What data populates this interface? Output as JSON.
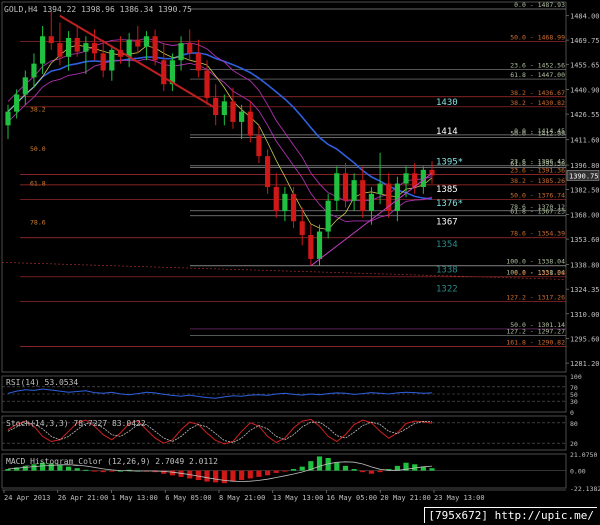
{
  "chart_data": [
    {
      "type": "candlestick",
      "panel": "price",
      "header": "GOLD,H4  1394.22 1398.96 1386.34 1390.75",
      "yticks": [
        "1484.00",
        "1469.75",
        "1455.65",
        "1440.90",
        "1426.55",
        "1411.60",
        "1396.80",
        "1382.50",
        "1368.00",
        "1353.60",
        "1338.80",
        "1324.35",
        "1310.00",
        "1295.60",
        "1281.20"
      ],
      "ylim": [
        1276,
        1492
      ],
      "current_price": "1390.75",
      "xticks": [
        "24 Apr 2013",
        "26 Apr 21:00",
        "1 May 13:00",
        "6 May 05:00",
        "8 May 21:00",
        "13 May 13:00",
        "16 May 05:00",
        "20 May 21:00",
        "23 May 13:00"
      ],
      "candles": [
        {
          "o": 1420.0,
          "h": 1432.0,
          "l": 1412.0,
          "c": 1428.0
        },
        {
          "o": 1428.0,
          "h": 1441.0,
          "l": 1424.0,
          "c": 1438.0
        },
        {
          "o": 1438.0,
          "h": 1452.0,
          "l": 1432.0,
          "c": 1448.0
        },
        {
          "o": 1448.0,
          "h": 1462.0,
          "l": 1442.0,
          "c": 1456.0
        },
        {
          "o": 1456.0,
          "h": 1478.0,
          "l": 1450.0,
          "c": 1472.0
        },
        {
          "o": 1472.0,
          "h": 1487.0,
          "l": 1464.0,
          "c": 1468.0
        },
        {
          "o": 1468.0,
          "h": 1480.0,
          "l": 1455.0,
          "c": 1460.0
        },
        {
          "o": 1460.0,
          "h": 1475.0,
          "l": 1452.0,
          "c": 1471.0
        },
        {
          "o": 1471.0,
          "h": 1478.0,
          "l": 1460.0,
          "c": 1463.0
        },
        {
          "o": 1463.0,
          "h": 1472.0,
          "l": 1450.0,
          "c": 1468.0
        },
        {
          "o": 1468.0,
          "h": 1476.0,
          "l": 1458.0,
          "c": 1462.0
        },
        {
          "o": 1462.0,
          "h": 1470.0,
          "l": 1448.0,
          "c": 1452.0
        },
        {
          "o": 1452.0,
          "h": 1466.0,
          "l": 1446.0,
          "c": 1464.0
        },
        {
          "o": 1464.0,
          "h": 1472.0,
          "l": 1456.0,
          "c": 1460.0
        },
        {
          "o": 1460.0,
          "h": 1474.0,
          "l": 1454.0,
          "c": 1470.0
        },
        {
          "o": 1470.0,
          "h": 1478.0,
          "l": 1462.0,
          "c": 1466.0
        },
        {
          "o": 1466.0,
          "h": 1475.0,
          "l": 1458.0,
          "c": 1472.0
        },
        {
          "o": 1472.0,
          "h": 1476.0,
          "l": 1455.0,
          "c": 1458.0
        },
        {
          "o": 1458.0,
          "h": 1468.0,
          "l": 1440.0,
          "c": 1444.0
        },
        {
          "o": 1444.0,
          "h": 1462.0,
          "l": 1440.0,
          "c": 1458.0
        },
        {
          "o": 1458.0,
          "h": 1472.0,
          "l": 1452.0,
          "c": 1468.0
        },
        {
          "o": 1468.0,
          "h": 1476.0,
          "l": 1458.0,
          "c": 1462.0
        },
        {
          "o": 1462.0,
          "h": 1470.0,
          "l": 1448.0,
          "c": 1452.0
        },
        {
          "o": 1452.0,
          "h": 1458.0,
          "l": 1432.0,
          "c": 1436.0
        },
        {
          "o": 1436.0,
          "h": 1444.0,
          "l": 1420.0,
          "c": 1426.0
        },
        {
          "o": 1426.0,
          "h": 1438.0,
          "l": 1420.0,
          "c": 1434.0
        },
        {
          "o": 1434.0,
          "h": 1442.0,
          "l": 1418.0,
          "c": 1422.0
        },
        {
          "o": 1422.0,
          "h": 1432.0,
          "l": 1412.0,
          "c": 1428.0
        },
        {
          "o": 1428.0,
          "h": 1434.0,
          "l": 1410.0,
          "c": 1414.0
        },
        {
          "o": 1414.0,
          "h": 1420.0,
          "l": 1398.0,
          "c": 1402.0
        },
        {
          "o": 1402.0,
          "h": 1406.0,
          "l": 1380.0,
          "c": 1384.0
        },
        {
          "o": 1384.0,
          "h": 1392.0,
          "l": 1366.0,
          "c": 1370.0
        },
        {
          "o": 1370.0,
          "h": 1384.0,
          "l": 1364.0,
          "c": 1380.0
        },
        {
          "o": 1380.0,
          "h": 1384.0,
          "l": 1360.0,
          "c": 1364.0
        },
        {
          "o": 1364.0,
          "h": 1372.0,
          "l": 1350.0,
          "c": 1356.0
        },
        {
          "o": 1356.0,
          "h": 1362.0,
          "l": 1338.0,
          "c": 1342.0
        },
        {
          "o": 1342.0,
          "h": 1362.0,
          "l": 1338.0,
          "c": 1358.0
        },
        {
          "o": 1358.0,
          "h": 1380.0,
          "l": 1354.0,
          "c": 1376.0
        },
        {
          "o": 1376.0,
          "h": 1396.0,
          "l": 1370.0,
          "c": 1392.0
        },
        {
          "o": 1392.0,
          "h": 1398.0,
          "l": 1372.0,
          "c": 1376.0
        },
        {
          "o": 1376.0,
          "h": 1392.0,
          "l": 1370.0,
          "c": 1388.0
        },
        {
          "o": 1388.0,
          "h": 1396.0,
          "l": 1366.0,
          "c": 1370.0
        },
        {
          "o": 1370.0,
          "h": 1384.0,
          "l": 1362.0,
          "c": 1380.0
        },
        {
          "o": 1380.0,
          "h": 1404.0,
          "l": 1374.0,
          "c": 1386.0
        },
        {
          "o": 1386.0,
          "h": 1392.0,
          "l": 1366.0,
          "c": 1370.0
        },
        {
          "o": 1370.0,
          "h": 1390.0,
          "l": 1364.0,
          "c": 1386.0
        },
        {
          "o": 1386.0,
          "h": 1396.0,
          "l": 1378.0,
          "c": 1392.0
        },
        {
          "o": 1392.0,
          "h": 1398.0,
          "l": 1380.0,
          "c": 1384.0
        },
        {
          "o": 1384.0,
          "h": 1396.0,
          "l": 1380.0,
          "c": 1394.0
        },
        {
          "o": 1394.0,
          "h": 1399.0,
          "l": 1386.0,
          "c": 1390.75
        }
      ],
      "fib_levels": [
        {
          "label": "0.0 - 1487.93",
          "price": 1487.93,
          "color": "#8a8a8a"
        },
        {
          "label": "50.0 - 1468.99",
          "price": 1468.99,
          "color": "#b03030"
        },
        {
          "label": "23.6 - 1452.56",
          "price": 1452.56,
          "color": "#8a8a8a"
        },
        {
          "label": "61.8 - 1447.00",
          "price": 1447.0,
          "color": "#8a8a8a"
        },
        {
          "label": "38.2 - 1436.67",
          "price": 1436.67,
          "color": "#b03030"
        },
        {
          "label": "38.2 - 1430.82",
          "price": 1430.82,
          "color": "#b03030"
        },
        {
          "label": "0.0 - 1414.45",
          "price": 1414.45,
          "color": "#8a8a8a"
        },
        {
          "label": "50.0 - 1412.99",
          "price": 1412.99,
          "color": "#8a8a8a"
        },
        {
          "label": "23.6 - 1396.42",
          "price": 1396.42,
          "color": "#8a8a8a"
        },
        {
          "label": "61.8 - 1395.30",
          "price": 1395.3,
          "color": "#8a8a8a"
        },
        {
          "label": "23.6 - 1391.36",
          "price": 1391.36,
          "color": "#b03030"
        },
        {
          "label": "38.2 - 1385.26",
          "price": 1385.26,
          "color": "#b03030"
        },
        {
          "label": "50.0 - 1376.74",
          "price": 1376.74,
          "color": "#b03030"
        },
        {
          "label": "78.6 - 1370.12",
          "price": 1370.12,
          "color": "#8a8a8a"
        },
        {
          "label": "61.8 - 1367.23",
          "price": 1367.23,
          "color": "#8a8a8a"
        },
        {
          "label": "78.6 - 1354.39",
          "price": 1354.39,
          "color": "#b03030"
        },
        {
          "label": "100.0 - 1338.04",
          "price": 1338.04,
          "color": "#8a8a8a"
        },
        {
          "label": "100.0 - 1338.04",
          "price": 1338.04,
          "color": "#8a8a8a"
        },
        {
          "label": "0.0 - 1331.58",
          "price": 1331.58,
          "color": "#b03030"
        },
        {
          "label": "127.2 - 1317.26",
          "price": 1317.26,
          "color": "#b03030"
        },
        {
          "label": "50.0 - 1301.14",
          "price": 1301.14,
          "color": "#8a3a8a"
        },
        {
          "label": "127.2 - 1297.27",
          "price": 1297.27,
          "color": "#8a8a8a"
        },
        {
          "label": "161.8 - 1290.82",
          "price": 1290.82,
          "color": "#b03030"
        }
      ],
      "left_fib_labels": [
        {
          "label": "38.2",
          "price": 1428.0
        },
        {
          "label": "50.0",
          "price": 1405.0
        },
        {
          "label": "61.8",
          "price": 1385.0
        },
        {
          "label": "78.6",
          "price": 1362.0
        }
      ],
      "callouts": [
        {
          "text": "1430",
          "price": 1432.0,
          "color": "#7fe0e0"
        },
        {
          "text": "1414",
          "price": 1415.0,
          "color": "#ffffff"
        },
        {
          "text": "1395*",
          "price": 1397.0,
          "color": "#7fe0e0"
        },
        {
          "text": "1385",
          "price": 1381.0,
          "color": "#ffffff"
        },
        {
          "text": "1376*",
          "price": 1373.0,
          "color": "#7fe0e0"
        },
        {
          "text": "1367",
          "price": 1362.0,
          "color": "#ffffff"
        },
        {
          "text": "1354",
          "price": 1349.0,
          "color": "#2a8a8a"
        },
        {
          "text": "1338",
          "price": 1334.0,
          "color": "#2a8a8a"
        },
        {
          "text": "1322",
          "price": 1323.0,
          "color": "#2a8a8a"
        }
      ]
    },
    {
      "type": "line",
      "panel": "rsi",
      "label": "RSI(14) 53.0534",
      "ticks": [
        "100",
        "70",
        "50",
        "30",
        "0"
      ],
      "ylim": [
        0,
        100
      ],
      "values": [
        52,
        58,
        62,
        60,
        64,
        61,
        58,
        55,
        57,
        59,
        54,
        52,
        55,
        50,
        48,
        51,
        55,
        53,
        49,
        46,
        44,
        47,
        43,
        40,
        38,
        42,
        45,
        44,
        47,
        48,
        46,
        50,
        52,
        49,
        47,
        50,
        48,
        51,
        53,
        52,
        49,
        51,
        54,
        52,
        50,
        53,
        55,
        54,
        52,
        53
      ]
    },
    {
      "type": "line",
      "panel": "stochastic",
      "label": "Stoch(14,3,3) 78.7227 83.0422",
      "ticks": [
        "80",
        "20"
      ],
      "ylim": [
        0,
        100
      ],
      "series": [
        {
          "values": [
            60,
            75,
            85,
            70,
            40,
            25,
            30,
            55,
            80,
            88,
            70,
            45,
            30,
            50,
            78,
            86,
            60,
            35,
            20,
            30,
            60,
            82,
            75,
            50,
            28,
            18,
            25,
            55,
            80,
            70,
            40,
            22,
            35,
            65,
            85,
            90,
            70,
            40,
            25,
            45,
            75,
            88,
            80,
            55,
            35,
            50,
            78,
            85,
            83,
            78.7
          ]
        },
        {
          "values": [
            55,
            68,
            78,
            78,
            62,
            40,
            30,
            40,
            60,
            78,
            80,
            65,
            45,
            40,
            55,
            75,
            75,
            55,
            35,
            25,
            40,
            62,
            75,
            68,
            48,
            28,
            22,
            35,
            58,
            72,
            62,
            40,
            30,
            45,
            68,
            82,
            82,
            65,
            42,
            35,
            52,
            72,
            82,
            75,
            55,
            48,
            62,
            78,
            84,
            83.0
          ]
        }
      ]
    },
    {
      "type": "bar",
      "panel": "macd",
      "label": "MACD_Histogram_Color (12,26,9)  2.7049 2.0112",
      "ticks": [
        "21.0750",
        "0.00",
        "-22.1382"
      ],
      "ylim": [
        -22.14,
        21.08
      ],
      "values": [
        2,
        4,
        6,
        8,
        10,
        9,
        7,
        5,
        3,
        1,
        -1,
        -2,
        -1,
        0,
        1,
        0,
        -1,
        -2,
        -4,
        -6,
        -8,
        -10,
        -12,
        -14,
        -15,
        -16,
        -14,
        -12,
        -10,
        -8,
        -6,
        -3,
        -1,
        2,
        5,
        12,
        18,
        16,
        10,
        6,
        2,
        -2,
        -4,
        -2,
        2,
        6,
        10,
        8,
        5,
        3
      ]
    }
  ],
  "watermark": "[795x672] http://upic.me/"
}
